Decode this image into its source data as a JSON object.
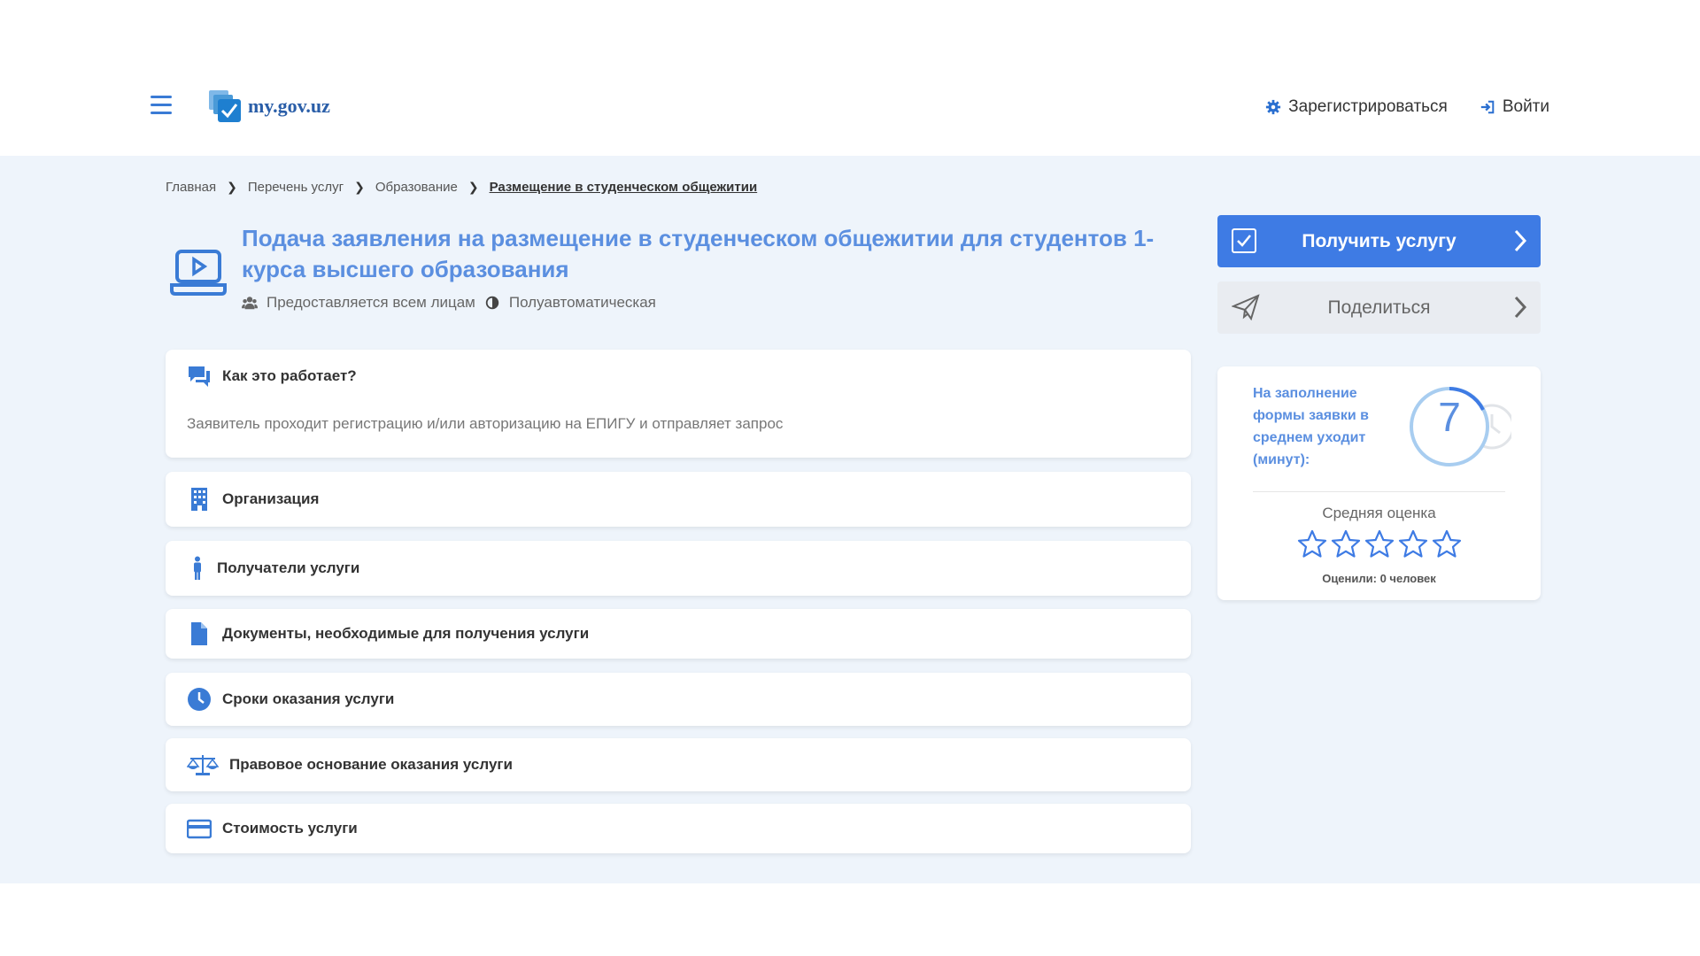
{
  "header": {
    "logo_text": "my.gov.uz",
    "register_label": "Зарегистрироваться",
    "login_label": "Войти"
  },
  "breadcrumb": {
    "items": [
      "Главная",
      "Перечень услуг",
      "Образование"
    ],
    "current": "Размещение в студенческом общежитии"
  },
  "service": {
    "title": "Подача заявления на размещение в студенческом общежитии для студентов 1-курса высшего образования",
    "audience": "Предоставляется всем лицам",
    "mode": "Полуавтоматическая"
  },
  "sections": {
    "how_it_works": {
      "title": "Как это работает?",
      "body": "Заявитель проходит регистрацию и/или авторизацию на ЕПИГУ и отправляет запрос"
    },
    "organization": "Организация",
    "recipients": "Получатели услуги",
    "documents": "Документы, необходимые для получения услуги",
    "terms": "Сроки оказания услуги",
    "legal": "Правовое основание оказания услуги",
    "cost": "Стоимость услуги"
  },
  "actions": {
    "get_service": "Получить услугу",
    "share": "Поделиться"
  },
  "stats": {
    "fill_time_label": "На заполнение формы заявки в среднем уходит (минут):",
    "fill_time_minutes": "7",
    "rating_label": "Средняя оценка",
    "rating_stars": 0,
    "rated_count": "Оценили: 0 человек"
  },
  "colors": {
    "accent": "#3e7be4",
    "title": "#5b8fe0",
    "background": "#eef4fb"
  }
}
